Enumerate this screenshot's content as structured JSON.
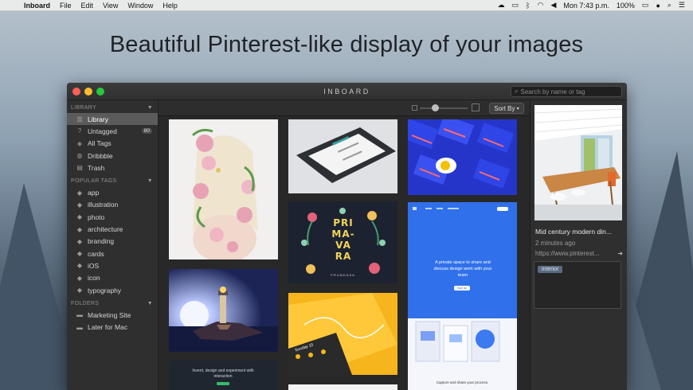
{
  "menubar": {
    "app_name": "Inboard",
    "menus": [
      "File",
      "Edit",
      "View",
      "Window",
      "Help"
    ],
    "clock": "Mon 7:43 p.m.",
    "battery": "100%"
  },
  "headline": "Beautiful Pinterest-like display of your images",
  "window": {
    "title": "INBOARD",
    "search_placeholder": "Search by name or tag"
  },
  "sidebar": {
    "library_header": "LIBRARY",
    "library_items": [
      {
        "label": "Library",
        "icon": "library-icon"
      },
      {
        "label": "Untagged",
        "icon": "question-icon",
        "badge": "80"
      },
      {
        "label": "All Tags",
        "icon": "tags-icon"
      },
      {
        "label": "Dribbble",
        "icon": "dribbble-icon"
      },
      {
        "label": "Trash",
        "icon": "trash-icon"
      }
    ],
    "popular_header": "POPULAR TAGS",
    "popular_tags": [
      "app",
      "illustration",
      "photo",
      "architecture",
      "branding",
      "cards",
      "iOS",
      "icon",
      "typography"
    ],
    "folders_header": "FOLDERS",
    "folders": [
      "Marketing Site",
      "Later for Mac"
    ]
  },
  "toolbar": {
    "sort_label": "Sort By"
  },
  "tiles": {
    "primavera_text": [
      "PRI",
      "MA-",
      "VA",
      "RA"
    ],
    "primavera_sub": "PRUMDASA",
    "blue_site_text": "A private space to share and discuss design work with your team",
    "blue_site_button": "Sign Up",
    "blue_site_footer": "Capture and share your process.",
    "dark_site_text": "Invent, design and experiment with interaction",
    "card_title": "Shashi S.A.",
    "dayoff_text": "Sunday 15"
  },
  "detail": {
    "title": "Mid century modern din...",
    "time": "2 minutes ago",
    "url": "https://www.pinterest...",
    "tag": "interior"
  }
}
